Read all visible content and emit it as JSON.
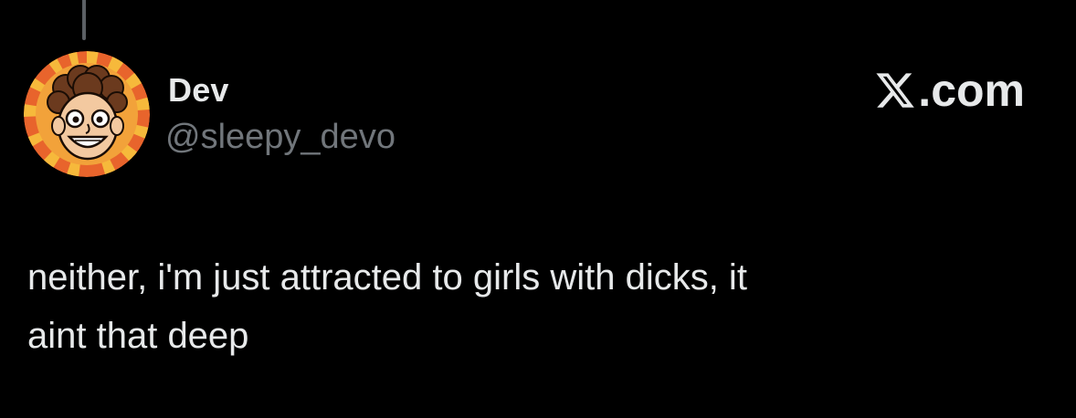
{
  "tweet": {
    "author_name": "Dev",
    "author_handle": "@sleepy_devo",
    "text_line1": "neither, i'm just attracted to girls with dicks, it",
    "text_line2": "aint that deep"
  },
  "brand": {
    "label": ".com",
    "icon": "x-logo-icon"
  },
  "colors": {
    "background": "#000000",
    "text_primary": "#e7e9ea",
    "text_secondary": "#71767b",
    "thread_line": "#5c6065",
    "avatar_ring_orange": "#e8642c",
    "avatar_ring_yellow": "#f6b93b"
  }
}
